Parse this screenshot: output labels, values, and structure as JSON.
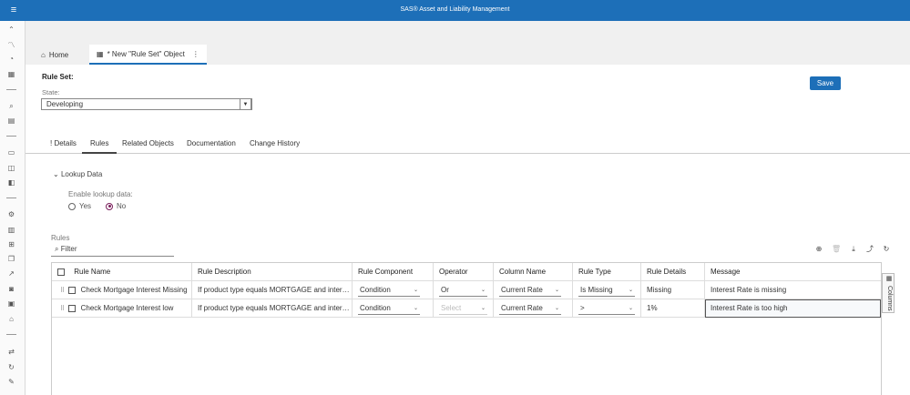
{
  "app": {
    "title": "SAS® Asset and Liability Management"
  },
  "tabs": {
    "home": "Home",
    "object": "* New \"Rule Set\" Object"
  },
  "ruleset": {
    "label": "Rule Set:",
    "save": "Save",
    "state_label": "State:",
    "state_value": "Developing"
  },
  "subtabs": [
    "! Details",
    "Rules",
    "Related Objects",
    "Documentation",
    "Change History"
  ],
  "lookup": {
    "toggle": "Lookup Data",
    "enable_label": "Enable lookup data:",
    "yes": "Yes",
    "no": "No",
    "selected": "No"
  },
  "rules": {
    "label": "Rules",
    "filter_placeholder": "Filter",
    "columns": [
      "Rule Name",
      "Rule Description",
      "Rule Component",
      "Operator",
      "Column Name",
      "Rule Type",
      "Rule Details",
      "Message"
    ],
    "rows": [
      {
        "name": "Check Mortgage Interest Missing",
        "description": "If product type equals MORTGAGE and intere…",
        "component": "Condition",
        "operator": "Or",
        "column": "Current Rate",
        "type": "Is Missing",
        "details": "Missing",
        "message": "Interest Rate is missing"
      },
      {
        "name": "Check Mortgage Interest low",
        "description": "If product type equals MORTGAGE and intere…",
        "component": "Condition",
        "operator": "Select",
        "column": "Current Rate",
        "type": ">",
        "details": "1%",
        "message": "Interest Rate is too high"
      }
    ]
  },
  "columns_panel": "Columns",
  "colors": {
    "header": "#1d6fb8",
    "radio_selected": "#7a1f5c"
  }
}
